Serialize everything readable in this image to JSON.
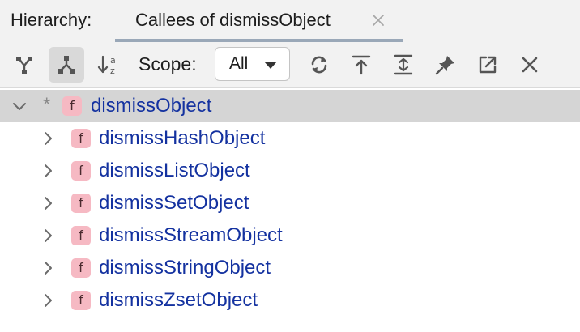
{
  "header": {
    "label": "Hierarchy:",
    "tab": {
      "title": "Callees of dismissObject",
      "close_icon": "close-icon"
    }
  },
  "toolbar": {
    "buttons": [
      {
        "icon": "caller-hierarchy-icon",
        "active": false
      },
      {
        "icon": "callee-hierarchy-icon",
        "active": true
      },
      {
        "icon": "sort-alphabetically-icon",
        "active": false
      },
      {
        "icon": "refresh-icon",
        "active": false
      },
      {
        "icon": "export-icon",
        "active": false
      },
      {
        "icon": "expand-all-icon",
        "active": false
      },
      {
        "icon": "pin-icon",
        "active": false
      },
      {
        "icon": "open-in-new-icon",
        "active": false
      },
      {
        "icon": "close-icon",
        "active": false
      }
    ],
    "scope": {
      "label": "Scope:",
      "value": "All"
    }
  },
  "tree": {
    "root": {
      "marker": "*",
      "badge": "f",
      "name": "dismissObject",
      "expanded": true,
      "selected": true
    },
    "children": [
      {
        "badge": "f",
        "name": "dismissHashObject"
      },
      {
        "badge": "f",
        "name": "dismissListObject"
      },
      {
        "badge": "f",
        "name": "dismissSetObject"
      },
      {
        "badge": "f",
        "name": "dismissStreamObject"
      },
      {
        "badge": "f",
        "name": "dismissStringObject"
      },
      {
        "badge": "f",
        "name": "dismissZsetObject"
      }
    ]
  },
  "colors": {
    "function_name": "#1432a0",
    "function_badge": "#f6b9c3",
    "selection": "#d5d5d5",
    "tab_underline": "#9aa8b8"
  }
}
